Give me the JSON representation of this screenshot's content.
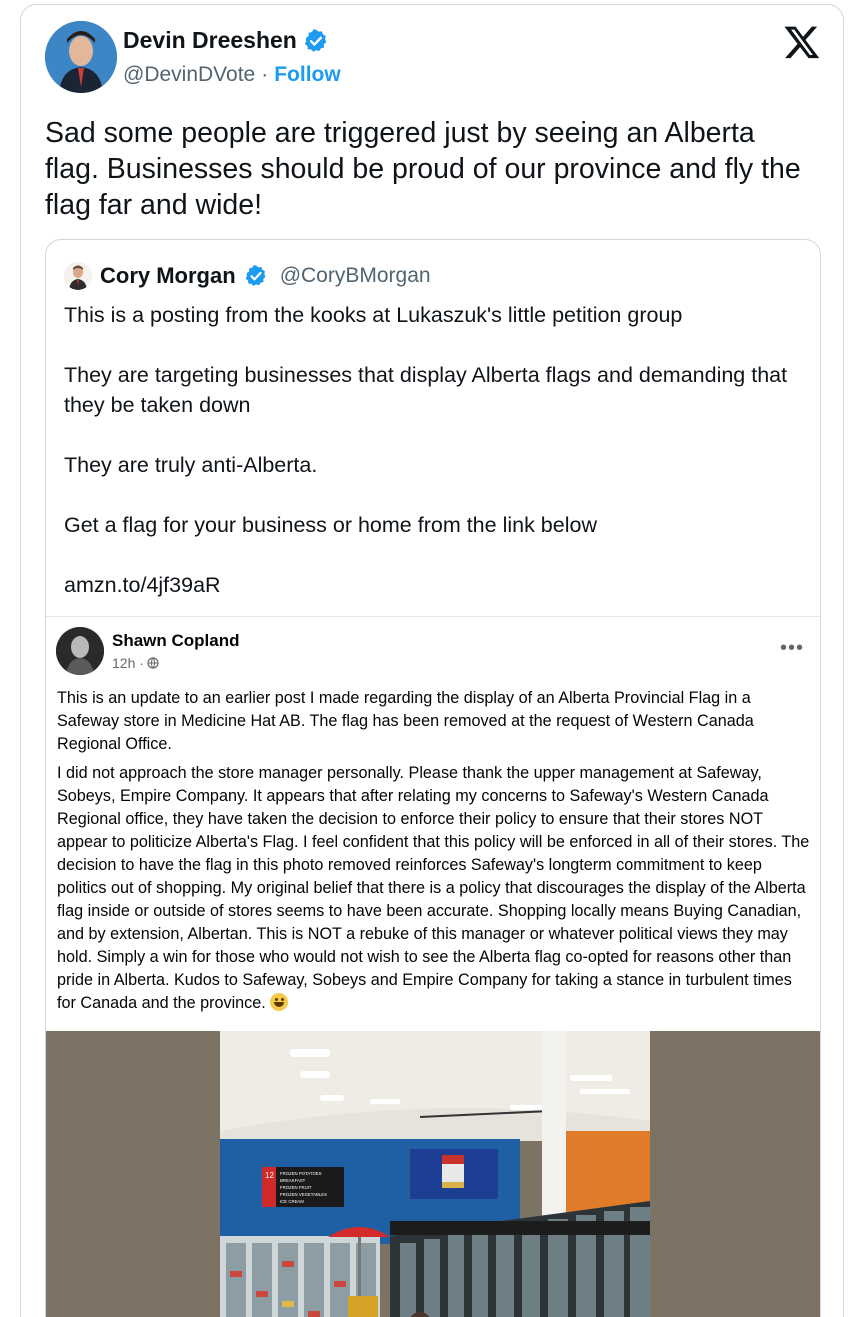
{
  "tweet": {
    "author_name": "Devin Dreeshen",
    "author_handle": "@DevinDVote",
    "separator": "·",
    "follow_label": "Follow",
    "text": "Sad some people are triggered just by seeing an Alberta flag. Businesses should be proud of our province and fly the flag far and wide!"
  },
  "quote": {
    "author_name": "Cory Morgan",
    "author_handle": "@CoryBMorgan",
    "lines": [
      "This is a posting from the kooks at Lukaszuk's little petition group",
      "They are targeting businesses that display Alberta flags and demanding that they be taken down",
      "They are truly anti-Alberta.",
      "Get a flag for your business or home from the link below",
      "amzn.to/4jf39aR"
    ]
  },
  "fb_post": {
    "author": "Shawn Copland",
    "time": "12h ·",
    "more": "•••",
    "paragraph1": "This is an update to an earlier post I made regarding the display of an Alberta Provincial Flag in a Safeway store in Medicine Hat AB. The flag has been removed at the request of Western Canada Regional Office.",
    "paragraph2": "I did not approach the store manager personally. Please thank the upper management at Safeway, Sobeys, Empire Company. It appears that after relating my concerns to Safeway's Western Canada Regional office, they have taken the decision to enforce their policy to ensure that their stores NOT appear to politicize Alberta's Flag. I feel confident that this policy will be enforced in all of their stores. The decision to have the flag in this photo removed reinforces Safeway's longterm commitment to keep politics out of shopping. My original belief that there is a policy that discourages the display of the Alberta flag inside or outside of stores seems to have been accurate. Shopping locally means Buying Canadian, and by extension, Albertan. This is NOT a rebuke of this manager or whatever political views they may hold. Simply a win for those who would not wish to see the Alberta flag co-opted for reasons other than pride in Alberta. Kudos to Safeway, Sobeys and Empire Company for taking a stance in turbulent times for Canada and the province.",
    "emoji": "smiley-emoji"
  },
  "store_sign": {
    "number": "12",
    "lines": [
      "FROZEN POTATOES",
      "BREAKFAST",
      "FROZEN FRUIT",
      "FROZEN VEGETABLES",
      "ICE CREAM"
    ]
  },
  "colors": {
    "verified": "#1d9bf0",
    "link": "#1d9bf0",
    "border": "#cfd9de",
    "muted": "#536471",
    "store_wall_blue": "#1f5fa3",
    "store_wall_orange": "#e07b2a",
    "flag_blue": "#1c3f94"
  },
  "icons": [
    "verified-badge-icon",
    "x-logo-icon",
    "globe-icon",
    "more-options-icon"
  ]
}
